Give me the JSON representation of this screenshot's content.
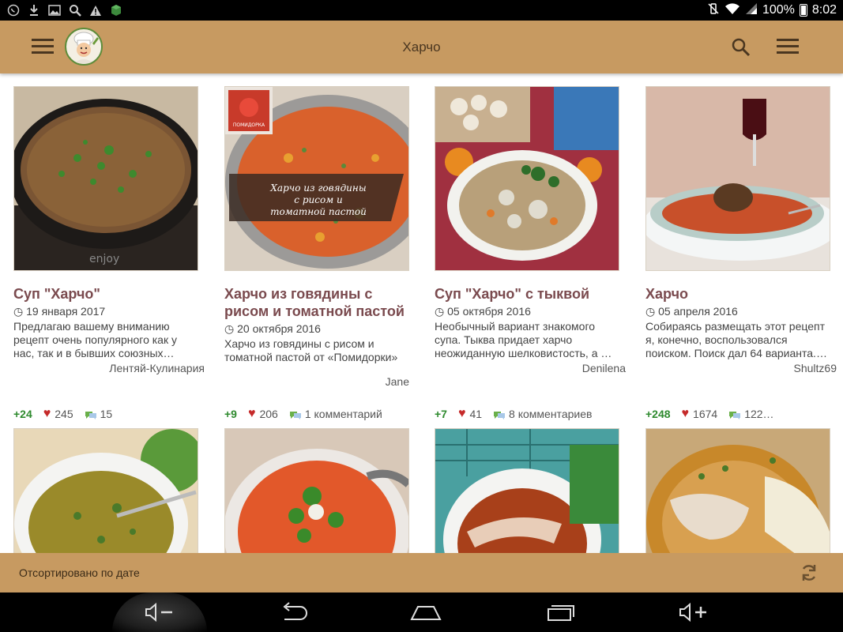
{
  "status_bar": {
    "battery": "100%",
    "time": "8:02"
  },
  "app_bar": {
    "title": "Харчо"
  },
  "recipes": [
    {
      "title": "Суп \"Харчо\"",
      "date": "19 января 2017",
      "description": "Предлагаю вашему вниманию рецепт очень популярного как у нас, так и в бывших союзных…",
      "author": "Лентяй-Кулинария",
      "score": "+24",
      "likes": "245",
      "comments": "15"
    },
    {
      "title": "Харчо из говядины с рисом и томатной пастой",
      "date": "20 октября 2016",
      "description": "Харчо из говядины с рисом и томатной пастой от «Помидорки»",
      "author": "Jane",
      "score": "+9",
      "likes": "206",
      "comments": "1 комментарий",
      "overlay_text": "Харчо из говядины с рисом и томатной пастой",
      "badge_text": "ПОМИДОРКА"
    },
    {
      "title": "Суп \"Харчо\" с тыквой",
      "date": "05 октября 2016",
      "description": "Необычный вариант знакомого супа. Тыква придает харчо неожиданную шелковистость, а …",
      "author": "Denilena",
      "score": "+7",
      "likes": "41",
      "comments": "8 комментариев"
    },
    {
      "title": "Харчо",
      "date": "05 апреля 2016",
      "description": "Собираясь размещать этот рецепт я, конечно, воспользовался поиском. Поиск дал 64 варианта.…",
      "author": "Shultz69",
      "score": "+248",
      "likes": "1674",
      "comments": "122…"
    }
  ],
  "sort_bar": {
    "label": "Отсортировано по дате"
  },
  "colors": {
    "app_bar": "#c79a61",
    "title_text": "#7a4a4e",
    "score_green": "#2e8a2e",
    "heart_red": "#c52a2a"
  },
  "icons": [
    "menu-icon",
    "chef-logo",
    "search-icon",
    "overflow-menu-icon",
    "clock-icon",
    "heart-icon",
    "comment-icon",
    "refresh-icon",
    "volume-down-icon",
    "back-icon",
    "home-icon",
    "recent-apps-icon",
    "volume-up-icon"
  ]
}
